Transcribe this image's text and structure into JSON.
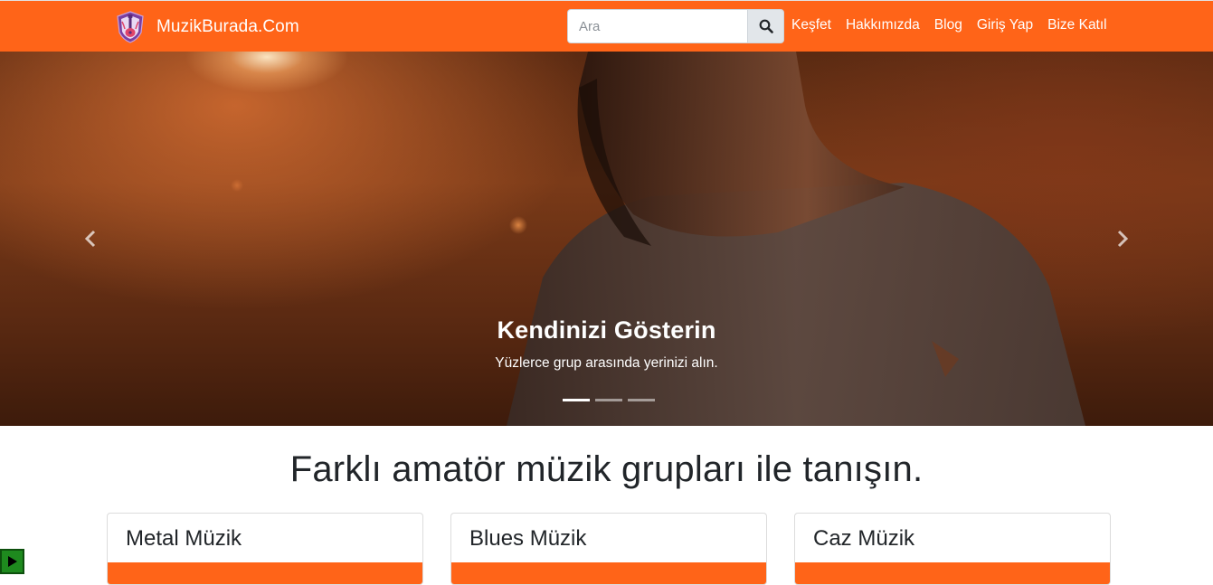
{
  "brand": {
    "name": "MuzikBurada.Com",
    "logo_icon": "guitar-logo-icon"
  },
  "search": {
    "placeholder": "Ara",
    "value": "",
    "button_icon": "search-icon"
  },
  "nav": {
    "links": [
      {
        "label": "Keşfet"
      },
      {
        "label": "Hakkımızda"
      },
      {
        "label": "Blog"
      },
      {
        "label": "Giriş Yap"
      },
      {
        "label": "Bize Katıl"
      }
    ]
  },
  "carousel": {
    "title": "Kendinizi Gösterin",
    "text": "Yüzlerce grup arasında yerinizi alın.",
    "prev_icon": "chevron-left-icon",
    "next_icon": "chevron-right-icon",
    "slide_count": 3,
    "active_slide": 1
  },
  "section": {
    "heading": "Farklı amatör müzik grupları ile tanışın."
  },
  "cards": [
    {
      "title": "Metal Müzik"
    },
    {
      "title": "Blues Müzik"
    },
    {
      "title": "Caz Müzik"
    }
  ],
  "colors": {
    "accent": "#ff6418",
    "text": "#212529"
  }
}
